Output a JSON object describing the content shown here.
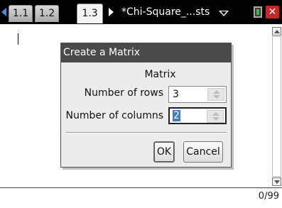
{
  "tabs": [
    {
      "label": "1.1",
      "active": false
    },
    {
      "label": "1.2",
      "active": false
    },
    {
      "label": "1.3",
      "active": true
    }
  ],
  "document": {
    "title": "*Chi-Square_...sts"
  },
  "icons": {
    "nav_left": "left-arrow-icon",
    "nav_right": "right-arrow-icon",
    "doc_menu": "chevron-down-icon",
    "battery": "battery-icon",
    "close": "close-icon"
  },
  "dialog": {
    "title": "Create a Matrix",
    "subtitle": "Matrix",
    "rows_label": "Number of rows",
    "rows_value": "3",
    "cols_label": "Number of columns",
    "cols_value": "2",
    "ok_label": "OK",
    "cancel_label": "Cancel"
  },
  "entry": {
    "counter": "0/99"
  },
  "colors": {
    "accent": "#3a7bd5",
    "close": "#c62828",
    "titlebar": "#4a4a4a"
  }
}
